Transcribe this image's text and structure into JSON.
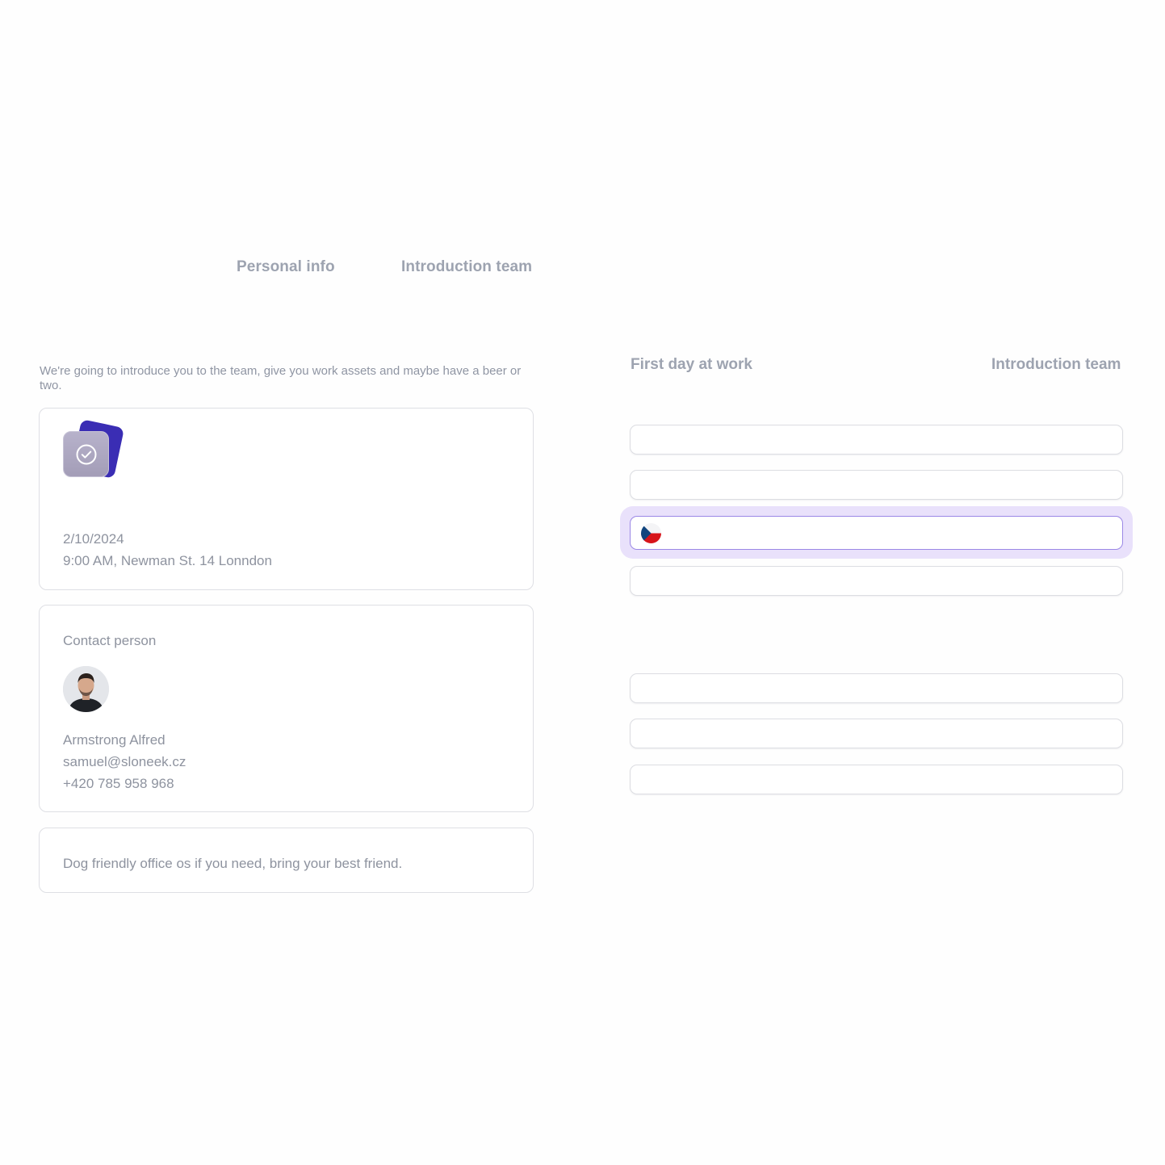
{
  "tabs": {
    "personal_info": "Personal info",
    "introduction_team": "Introduction team"
  },
  "left": {
    "intro_text": "We're going to introduce you to the team, give you work assets and maybe have a beer or two.",
    "first_day_card": {
      "icon": "check-circle-icon",
      "date": "2/10/2024",
      "time_location": "9:00 AM, Newman St. 14 Lonndon"
    },
    "contact_card": {
      "title": "Contact person",
      "name": "Armstrong Alfred",
      "email": "samuel@sloneek.cz",
      "phone": "+420 785 958 968"
    },
    "note_card": {
      "text": "Dog friendly office os if you need, bring your best friend."
    }
  },
  "right": {
    "heading_left": "First day at work",
    "heading_right": "Introduction team",
    "phone_field": {
      "country_flag": "czech-flag-icon",
      "value": ""
    },
    "fields": [
      "",
      "",
      "",
      "",
      "",
      ""
    ]
  },
  "colors": {
    "brand_indigo": "#3a2db4",
    "focus_ring": "#e9e1fb",
    "focus_border": "#9b88e6",
    "muted_text": "#9da3b0"
  }
}
